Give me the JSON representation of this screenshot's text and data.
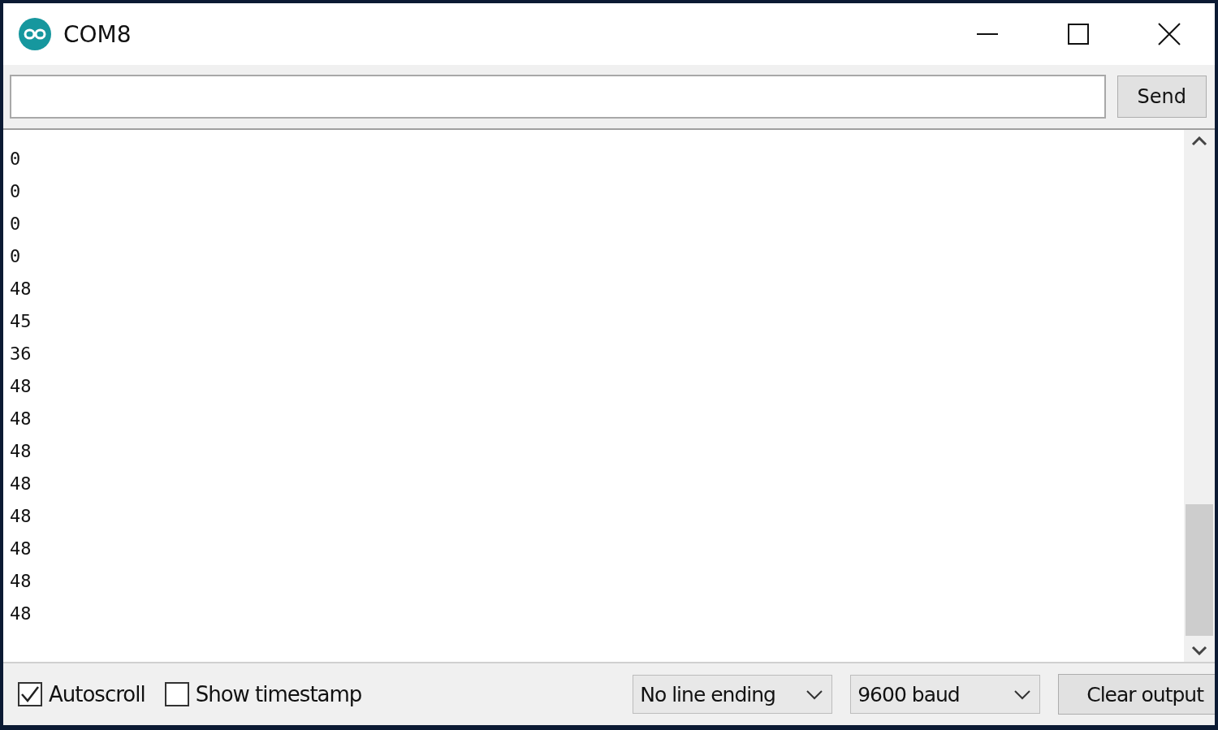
{
  "window": {
    "title": "COM8"
  },
  "send_bar": {
    "send_button": "Send"
  },
  "output": {
    "lines": [
      "0",
      "0",
      "0",
      "0",
      "48",
      "45",
      "36",
      "48",
      "48",
      "48",
      "48",
      "48",
      "48",
      "48",
      "48"
    ]
  },
  "footer": {
    "autoscroll": {
      "label": "Autoscroll",
      "checked": true
    },
    "show_timestamp": {
      "label": "Show timestamp",
      "checked": false
    },
    "line_ending": "No line ending",
    "baud": "9600 baud",
    "clear_button": "Clear output"
  }
}
